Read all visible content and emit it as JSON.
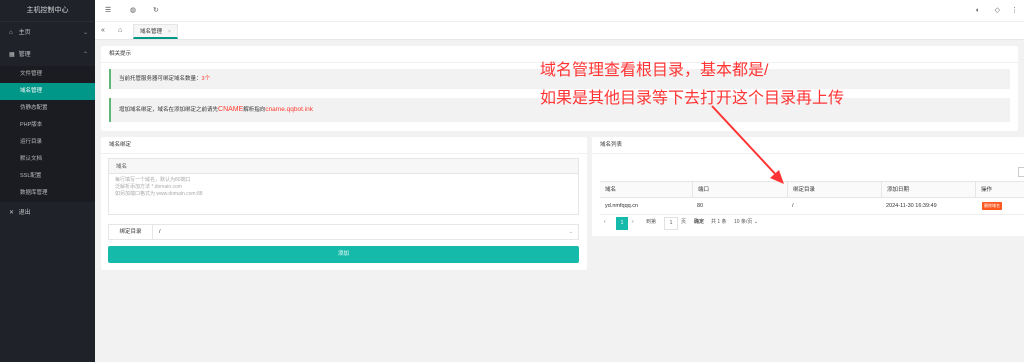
{
  "sidebar": {
    "logo": "主机控制中心",
    "home": {
      "icon": "home-icon",
      "label": "主页"
    },
    "manage": {
      "icon": "grid-icon",
      "label": "管理"
    },
    "items": [
      {
        "label": "文件管理"
      },
      {
        "label": "域名管理"
      },
      {
        "label": "伪静态配置"
      },
      {
        "label": "PHP版本"
      },
      {
        "label": "运行目录"
      },
      {
        "label": "默认文档"
      },
      {
        "label": "SSL配置"
      },
      {
        "label": "数据库管理"
      }
    ],
    "logout": {
      "icon": "close-icon",
      "label": "退出"
    },
    "active_color": "#009688"
  },
  "topbar": {
    "icons": [
      "menu-icon",
      "globe-icon",
      "refresh-icon",
      "theme-icon",
      "tag-icon",
      "more-icon"
    ]
  },
  "tabs": {
    "nav_icons": [
      "double-left-icon",
      "home-icon"
    ],
    "active": {
      "label": "域名管理",
      "close": "×"
    }
  },
  "tips_panel": {
    "title": "相关提示",
    "tip1_prefix": "当前托管服务器可绑定域名数量：",
    "tip1_count": "3个",
    "tip2_prefix": "增加域名绑定，域名在添加绑定之前请先",
    "tip2_cname": "CNAME",
    "tip2_mid": "解析指向",
    "tip2_target": "cname.qqbot.ink"
  },
  "bind_panel": {
    "title": "域名绑定",
    "domain_label": "域名",
    "placeholder_line1": "每行填写一个域名，默认为80端口",
    "placeholder_line2": "泛解析添加方法 *.domain.com",
    "placeholder_line3": "如另加端口格式为 www.domain.com:88",
    "dir_label": "绑定目录",
    "dir_value": "/",
    "submit": "添加",
    "accent": "#16baaa"
  },
  "list_panel": {
    "title": "域名列表",
    "columns": [
      "域名",
      "端口",
      "绑定目录",
      "添加日期",
      "操作"
    ],
    "rows": [
      {
        "domain": "yd.nmfqqq.cn",
        "port": "80",
        "dir": "/",
        "date": "2024-11-30 16:39:49",
        "action": "删除域名"
      }
    ],
    "pager": {
      "current": "1",
      "goto_prefix": "到第",
      "goto_page": "1",
      "goto_suffix": "页",
      "confirm": "确定",
      "total": "共 1 条",
      "per_page": "10 条/页"
    },
    "delete_color": "#ff5722"
  },
  "annotation": {
    "line1": "域名管理查看根目录，基本都是/",
    "line2": "如果是其他目录等下去打开这个目录再上传",
    "color": "#ff3535"
  }
}
